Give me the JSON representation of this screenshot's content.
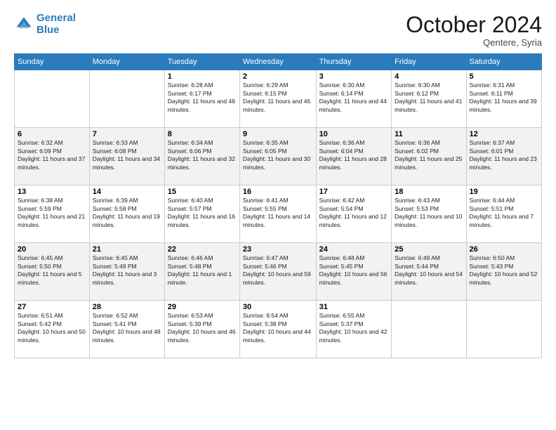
{
  "header": {
    "logo_line1": "General",
    "logo_line2": "Blue",
    "month": "October 2024",
    "location": "Qentere, Syria"
  },
  "days_of_week": [
    "Sunday",
    "Monday",
    "Tuesday",
    "Wednesday",
    "Thursday",
    "Friday",
    "Saturday"
  ],
  "weeks": [
    [
      {
        "day": "",
        "sunrise": "",
        "sunset": "",
        "daylight": ""
      },
      {
        "day": "",
        "sunrise": "",
        "sunset": "",
        "daylight": ""
      },
      {
        "day": "1",
        "sunrise": "Sunrise: 6:28 AM",
        "sunset": "Sunset: 6:17 PM",
        "daylight": "Daylight: 11 hours and 48 minutes."
      },
      {
        "day": "2",
        "sunrise": "Sunrise: 6:29 AM",
        "sunset": "Sunset: 6:15 PM",
        "daylight": "Daylight: 11 hours and 46 minutes."
      },
      {
        "day": "3",
        "sunrise": "Sunrise: 6:30 AM",
        "sunset": "Sunset: 6:14 PM",
        "daylight": "Daylight: 11 hours and 44 minutes."
      },
      {
        "day": "4",
        "sunrise": "Sunrise: 6:30 AM",
        "sunset": "Sunset: 6:12 PM",
        "daylight": "Daylight: 11 hours and 41 minutes."
      },
      {
        "day": "5",
        "sunrise": "Sunrise: 6:31 AM",
        "sunset": "Sunset: 6:11 PM",
        "daylight": "Daylight: 11 hours and 39 minutes."
      }
    ],
    [
      {
        "day": "6",
        "sunrise": "Sunrise: 6:32 AM",
        "sunset": "Sunset: 6:09 PM",
        "daylight": "Daylight: 11 hours and 37 minutes."
      },
      {
        "day": "7",
        "sunrise": "Sunrise: 6:33 AM",
        "sunset": "Sunset: 6:08 PM",
        "daylight": "Daylight: 11 hours and 34 minutes."
      },
      {
        "day": "8",
        "sunrise": "Sunrise: 6:34 AM",
        "sunset": "Sunset: 6:06 PM",
        "daylight": "Daylight: 11 hours and 32 minutes."
      },
      {
        "day": "9",
        "sunrise": "Sunrise: 6:35 AM",
        "sunset": "Sunset: 6:05 PM",
        "daylight": "Daylight: 11 hours and 30 minutes."
      },
      {
        "day": "10",
        "sunrise": "Sunrise: 6:36 AM",
        "sunset": "Sunset: 6:04 PM",
        "daylight": "Daylight: 11 hours and 28 minutes."
      },
      {
        "day": "11",
        "sunrise": "Sunrise: 6:36 AM",
        "sunset": "Sunset: 6:02 PM",
        "daylight": "Daylight: 11 hours and 25 minutes."
      },
      {
        "day": "12",
        "sunrise": "Sunrise: 6:37 AM",
        "sunset": "Sunset: 6:01 PM",
        "daylight": "Daylight: 11 hours and 23 minutes."
      }
    ],
    [
      {
        "day": "13",
        "sunrise": "Sunrise: 6:38 AM",
        "sunset": "Sunset: 5:59 PM",
        "daylight": "Daylight: 11 hours and 21 minutes."
      },
      {
        "day": "14",
        "sunrise": "Sunrise: 6:39 AM",
        "sunset": "Sunset: 5:58 PM",
        "daylight": "Daylight: 11 hours and 19 minutes."
      },
      {
        "day": "15",
        "sunrise": "Sunrise: 6:40 AM",
        "sunset": "Sunset: 5:57 PM",
        "daylight": "Daylight: 11 hours and 16 minutes."
      },
      {
        "day": "16",
        "sunrise": "Sunrise: 6:41 AM",
        "sunset": "Sunset: 5:55 PM",
        "daylight": "Daylight: 11 hours and 14 minutes."
      },
      {
        "day": "17",
        "sunrise": "Sunrise: 6:42 AM",
        "sunset": "Sunset: 5:54 PM",
        "daylight": "Daylight: 11 hours and 12 minutes."
      },
      {
        "day": "18",
        "sunrise": "Sunrise: 6:43 AM",
        "sunset": "Sunset: 5:53 PM",
        "daylight": "Daylight: 11 hours and 10 minutes."
      },
      {
        "day": "19",
        "sunrise": "Sunrise: 6:44 AM",
        "sunset": "Sunset: 5:51 PM",
        "daylight": "Daylight: 11 hours and 7 minutes."
      }
    ],
    [
      {
        "day": "20",
        "sunrise": "Sunrise: 6:45 AM",
        "sunset": "Sunset: 5:50 PM",
        "daylight": "Daylight: 11 hours and 5 minutes."
      },
      {
        "day": "21",
        "sunrise": "Sunrise: 6:45 AM",
        "sunset": "Sunset: 5:49 PM",
        "daylight": "Daylight: 11 hours and 3 minutes."
      },
      {
        "day": "22",
        "sunrise": "Sunrise: 6:46 AM",
        "sunset": "Sunset: 5:48 PM",
        "daylight": "Daylight: 11 hours and 1 minute."
      },
      {
        "day": "23",
        "sunrise": "Sunrise: 6:47 AM",
        "sunset": "Sunset: 5:46 PM",
        "daylight": "Daylight: 10 hours and 59 minutes."
      },
      {
        "day": "24",
        "sunrise": "Sunrise: 6:48 AM",
        "sunset": "Sunset: 5:45 PM",
        "daylight": "Daylight: 10 hours and 56 minutes."
      },
      {
        "day": "25",
        "sunrise": "Sunrise: 6:49 AM",
        "sunset": "Sunset: 5:44 PM",
        "daylight": "Daylight: 10 hours and 54 minutes."
      },
      {
        "day": "26",
        "sunrise": "Sunrise: 6:50 AM",
        "sunset": "Sunset: 5:43 PM",
        "daylight": "Daylight: 10 hours and 52 minutes."
      }
    ],
    [
      {
        "day": "27",
        "sunrise": "Sunrise: 6:51 AM",
        "sunset": "Sunset: 5:42 PM",
        "daylight": "Daylight: 10 hours and 50 minutes."
      },
      {
        "day": "28",
        "sunrise": "Sunrise: 6:52 AM",
        "sunset": "Sunset: 5:41 PM",
        "daylight": "Daylight: 10 hours and 48 minutes."
      },
      {
        "day": "29",
        "sunrise": "Sunrise: 6:53 AM",
        "sunset": "Sunset: 5:39 PM",
        "daylight": "Daylight: 10 hours and 46 minutes."
      },
      {
        "day": "30",
        "sunrise": "Sunrise: 6:54 AM",
        "sunset": "Sunset: 5:38 PM",
        "daylight": "Daylight: 10 hours and 44 minutes."
      },
      {
        "day": "31",
        "sunrise": "Sunrise: 6:55 AM",
        "sunset": "Sunset: 5:37 PM",
        "daylight": "Daylight: 10 hours and 42 minutes."
      },
      {
        "day": "",
        "sunrise": "",
        "sunset": "",
        "daylight": ""
      },
      {
        "day": "",
        "sunrise": "",
        "sunset": "",
        "daylight": ""
      }
    ]
  ]
}
